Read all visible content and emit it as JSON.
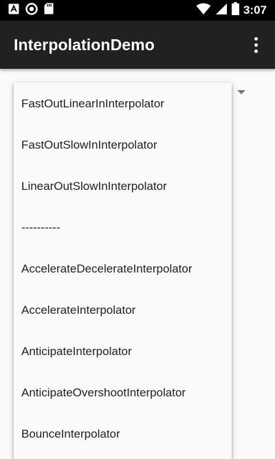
{
  "status_bar": {
    "time": "3:07",
    "left_icons": [
      "a-icon",
      "record-icon",
      "sd-card-icon"
    ],
    "right_icons": [
      "wifi-icon",
      "cellular-signal-icon",
      "battery-icon"
    ]
  },
  "app_bar": {
    "title": "InterpolationDemo",
    "overflow_icon": "more-vert-icon"
  },
  "dropdown": {
    "items": [
      "FastOutLinearInInterpolator",
      "FastOutSlowInInterpolator",
      "LinearOutSlowInInterpolator",
      "----------",
      "AccelerateDecelerateInterpolator",
      "AccelerateInterpolator",
      "AnticipateInterpolator",
      "AnticipateOvershootInterpolator",
      "BounceInterpolator"
    ]
  },
  "colors": {
    "status_bar": "#000000",
    "app_bar": "#212121",
    "background": "#fafafa",
    "text": "#212121"
  }
}
